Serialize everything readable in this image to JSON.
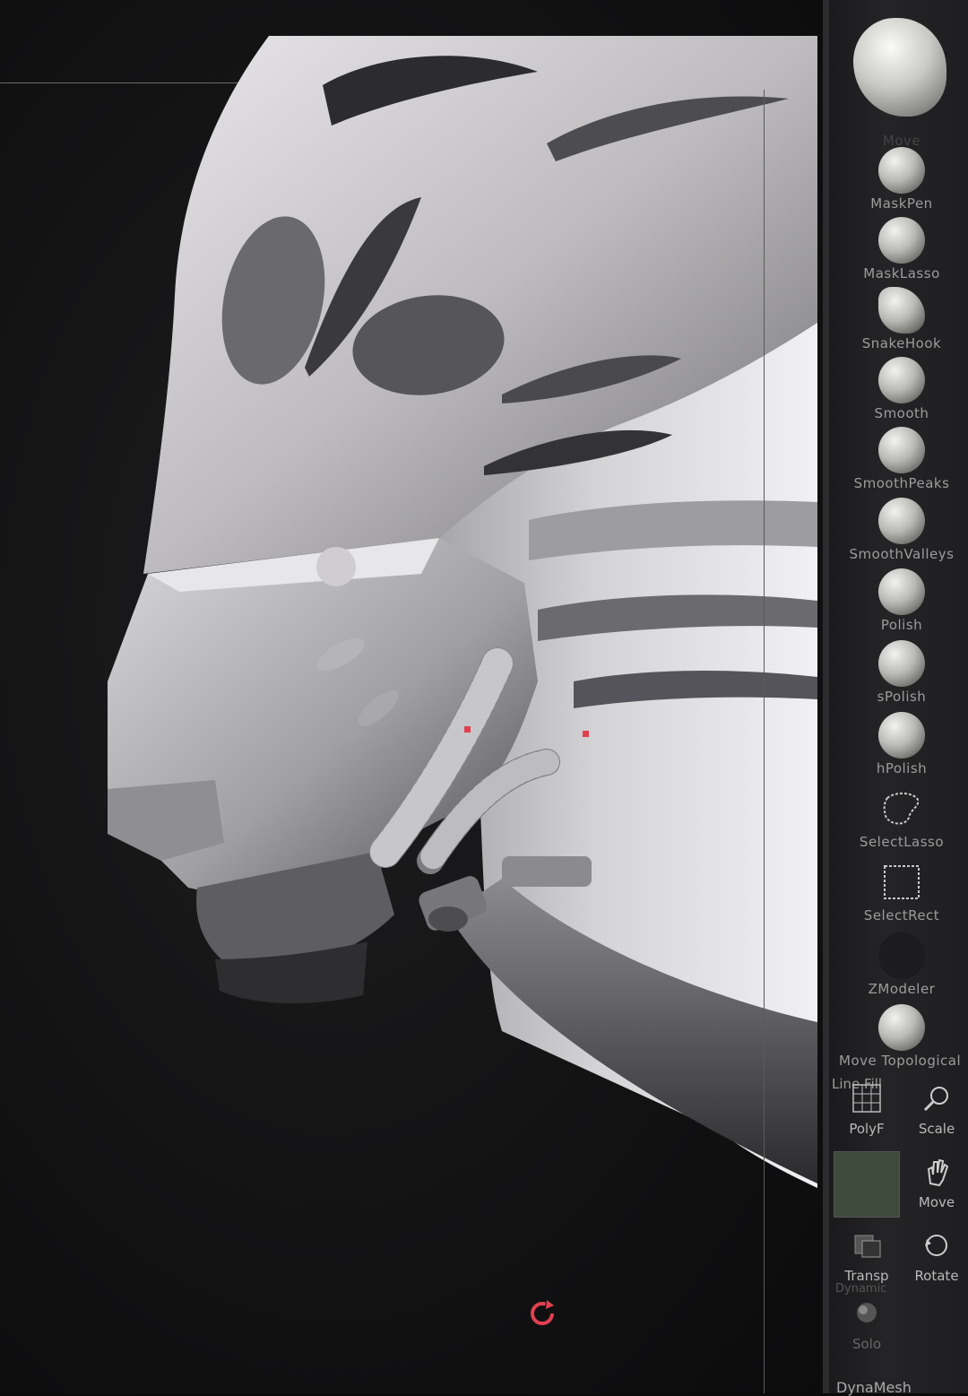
{
  "brushes": [
    {
      "label": "Move",
      "icon": "move-brush-icon"
    },
    {
      "label": "MaskPen",
      "icon": "maskpen-brush-icon"
    },
    {
      "label": "MaskLasso",
      "icon": "masklasso-brush-icon"
    },
    {
      "label": "SnakeHook",
      "icon": "snakehook-brush-icon"
    },
    {
      "label": "Smooth",
      "icon": "smooth-brush-icon"
    },
    {
      "label": "SmoothPeaks",
      "icon": "smoothpeaks-brush-icon"
    },
    {
      "label": "SmoothValleys",
      "icon": "smoothvalleys-brush-icon"
    },
    {
      "label": "Polish",
      "icon": "polish-brush-icon"
    },
    {
      "label": "sPolish",
      "icon": "spolish-brush-icon"
    },
    {
      "label": "hPolish",
      "icon": "hpolish-brush-icon"
    },
    {
      "label": "SelectLasso",
      "icon": "selectlasso-icon"
    },
    {
      "label": "SelectRect",
      "icon": "selectrect-icon"
    },
    {
      "label": "ZModeler",
      "icon": "zmodeler-brush-icon"
    },
    {
      "label": "Move  Topological",
      "icon": "move-topological-brush-icon"
    }
  ],
  "controls": {
    "line_fill": "Line Fill",
    "polyf": "PolyF",
    "scale": "Scale",
    "move": "Move",
    "transp": "Transp",
    "dynamic": "Dynamic",
    "rotate": "Rotate",
    "solo": "Solo",
    "dynamesh": "DynaMesh"
  },
  "colors": {
    "viewport_bg": "#131314",
    "shelf_bg": "#222224",
    "label": "#9c9c9c",
    "polyf_active": "#3e4a3c",
    "cursor_red": "#e04050"
  }
}
